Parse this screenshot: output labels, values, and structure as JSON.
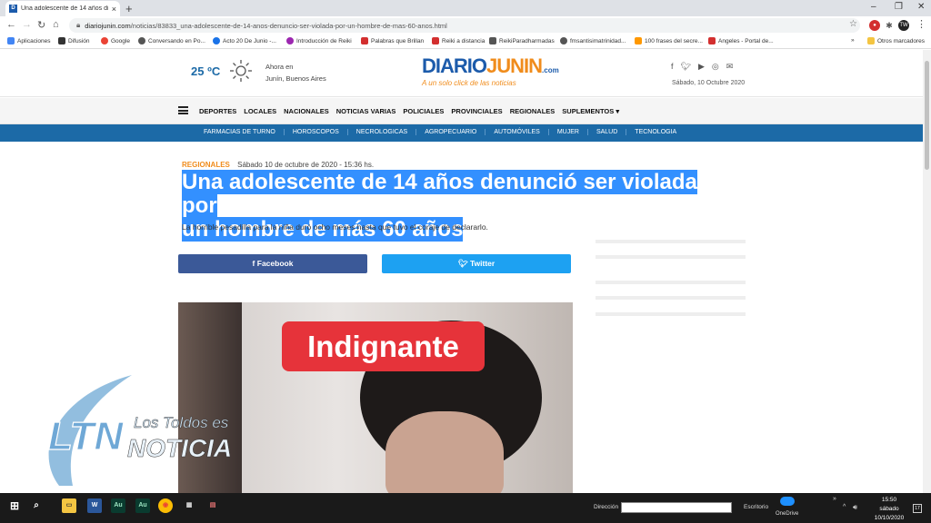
{
  "browser": {
    "tab_title": "Una adolescente de 14 años dnc",
    "tab_favicon": "D",
    "url_domain": "diariojunin.com",
    "url_path": "/noticias/83833_una-adolescente-de-14-anos-denuncio-ser-violada-por-un-hombre-de-mas-60-anos.html",
    "profile_initials": "TW"
  },
  "bookmarks": [
    {
      "label": "Aplicaciones",
      "color": "#4285f4"
    },
    {
      "label": "Difusión",
      "color": "#333333"
    },
    {
      "label": "Google",
      "color": "#ea4335"
    },
    {
      "label": "Conversando en Po...",
      "color": "#555555"
    },
    {
      "label": "Acto 20 De Junio -...",
      "color": "#1a73e8"
    },
    {
      "label": "Introducción de Reiki",
      "color": "#9c27b0"
    },
    {
      "label": "Palabras que Brillan",
      "color": "#d32f2f"
    },
    {
      "label": "Reiki a distancia",
      "color": "#d32f2f"
    },
    {
      "label": "ReikiParadharmadas",
      "color": "#555555"
    },
    {
      "label": "fmsantisimatrinidad...",
      "color": "#555555"
    },
    {
      "label": "100 frases del secre...",
      "color": "#ff9800"
    },
    {
      "label": "Angeles - Portal de...",
      "color": "#d32f2f"
    }
  ],
  "bookmarks_more": "»",
  "bookmarks_other": "Otros marcadores",
  "header": {
    "temperature": "25 ºC",
    "weather_line1": "Ahora en",
    "weather_line2": "Junín, Buenos Aires",
    "logo_part1": "DIARIO",
    "logo_part2": "JUNIN",
    "logo_suffix": ".com",
    "logo_tagline": "A un solo click de las noticias",
    "date": "Sábado, 10 Octubre 2020",
    "social_icons": [
      "facebook-icon",
      "twitter-icon",
      "youtube-icon",
      "instagram-icon",
      "email-icon"
    ]
  },
  "main_nav": [
    "DEPORTES",
    "LOCALES",
    "NACIONALES",
    "NOTICIAS VARIAS",
    "POLICIALES",
    "PROVINCIALES",
    "REGIONALES",
    "SUPLEMENTOS ▾"
  ],
  "sub_nav": [
    "FARMACIAS DE TURNO",
    "HOROSCOPOS",
    "NECROLOGICAS",
    "AGROPECUARIO",
    "AUTOMÓVILES",
    "MUJER",
    "SALUD",
    "TECNOLOGIA"
  ],
  "article": {
    "section": "REGIONALES",
    "datetime": "Sábado 10 de octubre de 2020 - 15:36 hs.",
    "headline_line1": "Una adolescente de 14 años denunció ser violada por",
    "headline_line2": "un hombre de más 60 años",
    "subhead": "La horrible pesadilla para la niña duró ocho meses hasta que tuvo el coraje de declararlo.",
    "share_facebook": "Facebook",
    "share_twitter": "Twitter",
    "image_overlay": "Indignante"
  },
  "watermark": {
    "ltn": "LTN",
    "los_toldos": "Los Toldos es",
    "noticia": "NOTICIA"
  },
  "taskbar": {
    "address_label": "Dirección",
    "desktop_label": "Escritorio",
    "onedrive_label": "OneDrive",
    "time": "15:50",
    "day": "sábado",
    "date": "10/10/2020",
    "notifications": "17"
  }
}
